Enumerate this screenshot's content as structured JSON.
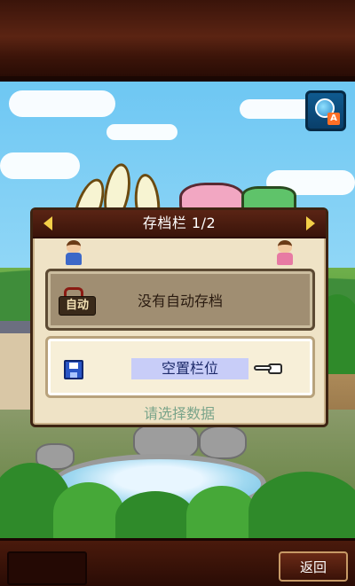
{
  "dialog": {
    "title": "存档栏 1/2",
    "auto_slot_label": "没有自动存档",
    "auto_icon_text": "自动",
    "empty_slot_label": "空置栏位",
    "hint": "请选择数据"
  },
  "bottom_bar": {
    "back_label": "返回"
  },
  "icons": {
    "lang_button": "globe-language-icon",
    "prev_page": "arrow-left-icon",
    "next_page": "arrow-right-icon",
    "disk": "floppy-disk-icon",
    "pointer": "pointing-hand-icon",
    "lang_badge": "A"
  },
  "colors": {
    "dialog_bg": "#efe3c6",
    "header_bg": "#3a140a",
    "arrow": "#f3cf48",
    "empty_highlight": "#c8cdf8",
    "hint_text": "#7aa48a"
  }
}
